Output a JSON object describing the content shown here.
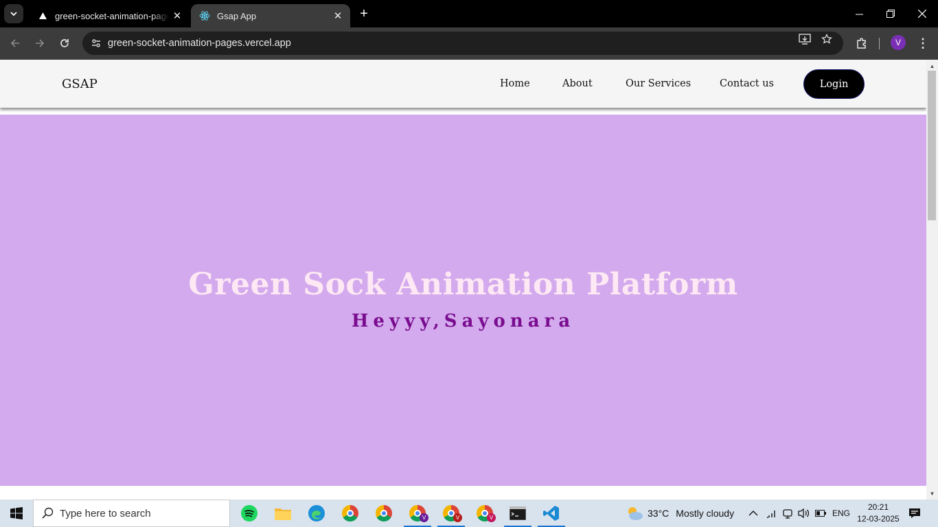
{
  "browser": {
    "tabs": [
      {
        "title": "green-socket-animation-pages",
        "favicon": "vercel-triangle-icon",
        "active": false
      },
      {
        "title": "Gsap App",
        "favicon": "react-icon",
        "active": true
      }
    ],
    "url": "green-socket-animation-pages.vercel.app",
    "profile_initial": "V"
  },
  "site": {
    "brand": "GSAP",
    "nav": [
      "Home",
      "About",
      "Our Services",
      "Contact us"
    ],
    "login_label": "Login",
    "hero_title": "Green Sock Animation Platform",
    "hero_subtitle": "Heyyy,Sayonara",
    "colors": {
      "hero_bg": "#d3aaed",
      "hero_title": "#fde8f4",
      "hero_subtitle": "#7a0d8f",
      "navbar_bg": "#f5f5f5"
    }
  },
  "taskbar": {
    "search_placeholder": "Type here to search",
    "weather_temp": "33°C",
    "weather_desc": "Mostly cloudy",
    "language": "ENG",
    "time": "20:21",
    "date": "12-03-2025",
    "badge_letters": [
      "V",
      "V",
      "V"
    ]
  }
}
